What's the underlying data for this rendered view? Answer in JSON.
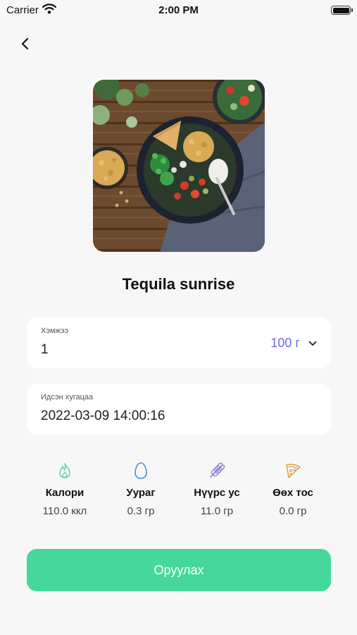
{
  "status_bar": {
    "carrier": "Carrier",
    "time": "2:00 PM"
  },
  "food": {
    "title": "Tequila sunrise"
  },
  "amount": {
    "label": "Хэмжээ",
    "value": "1",
    "unit": "100 г"
  },
  "time_eaten": {
    "label": "Идсэн хугацаа",
    "value": "2022-03-09 14:00:16"
  },
  "nutrients": [
    {
      "label": "Калори",
      "value": "110.0 ккл",
      "icon": "flame-icon",
      "color": "#5fd3a4"
    },
    {
      "label": "Уураг",
      "value": "0.3 гр",
      "icon": "egg-icon",
      "color": "#4a90d9"
    },
    {
      "label": "Нүүрс ус",
      "value": "11.0 гр",
      "icon": "grain-icon",
      "color": "#8a7fd8"
    },
    {
      "label": "Өөх тос",
      "value": "0.0 гр",
      "icon": "pizza-icon",
      "color": "#d9a04a"
    }
  ],
  "submit": {
    "label": "Оруулах"
  },
  "colors": {
    "accent": "#46d89a",
    "unit": "#6b6bf0",
    "background": "#f7f7f7"
  }
}
